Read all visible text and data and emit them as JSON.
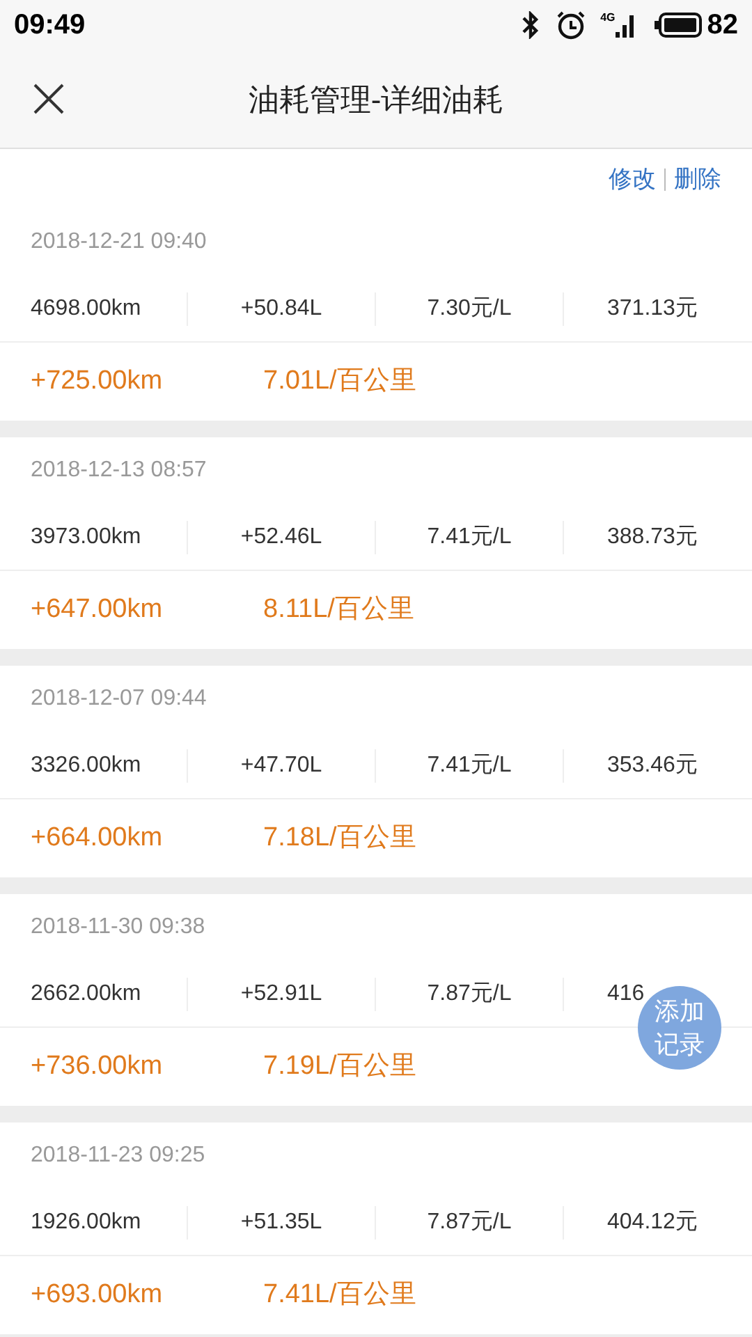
{
  "status_bar": {
    "time": "09:49",
    "network": "4G",
    "battery": "82"
  },
  "header": {
    "title": "油耗管理-详细油耗"
  },
  "actions": [
    "修改",
    "删除"
  ],
  "records": [
    {
      "date": "2018-12-21 09:40",
      "odometer": "4698.00km",
      "fuel": "+50.84L",
      "price": "7.30元/L",
      "total": "371.13元",
      "distance": "+725.00km",
      "consumption": "7.01L/百公里"
    },
    {
      "date": "2018-12-13 08:57",
      "odometer": "3973.00km",
      "fuel": "+52.46L",
      "price": "7.41元/L",
      "total": "388.73元",
      "distance": "+647.00km",
      "consumption": "8.11L/百公里"
    },
    {
      "date": "2018-12-07 09:44",
      "odometer": "3326.00km",
      "fuel": "+47.70L",
      "price": "7.41元/L",
      "total": "353.46元",
      "distance": "+664.00km",
      "consumption": "7.18L/百公里"
    },
    {
      "date": "2018-11-30 09:38",
      "odometer": "2662.00km",
      "fuel": "+52.91L",
      "price": "7.87元/L",
      "total": "416",
      "distance": "+736.00km",
      "consumption": "7.19L/百公里"
    },
    {
      "date": "2018-11-23 09:25",
      "odometer": "1926.00km",
      "fuel": "+51.35L",
      "price": "7.87元/L",
      "total": "404.12元",
      "distance": "+693.00km",
      "consumption": "7.41L/百公里"
    }
  ],
  "fab": {
    "label": "添加记录"
  }
}
